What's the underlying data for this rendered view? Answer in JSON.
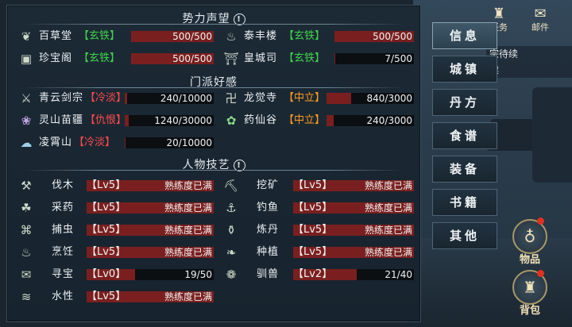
{
  "top_icons": [
    {
      "icon": "tower-icon",
      "label": "任务"
    },
    {
      "icon": "mail-icon",
      "label": "邮件"
    }
  ],
  "task_text": [
    "宗待续",
    "续"
  ],
  "sections": {
    "reputation": {
      "title": "势力声望",
      "items": [
        {
          "name": "百草堂",
          "tag": "【玄铁】",
          "value": "500/500",
          "fraction": 1.0,
          "icon": "herb-leaf-icon"
        },
        {
          "name": "泰丰楼",
          "tag": "【玄铁】",
          "value": "500/500",
          "fraction": 1.0,
          "icon": "cooking-pot-icon"
        },
        {
          "name": "珍宝阁",
          "tag": "【玄铁】",
          "value": "500/500",
          "fraction": 1.0,
          "icon": "treasure-chest-icon"
        },
        {
          "name": "皇城司",
          "tag": "【玄铁】",
          "value": "7/500",
          "fraction": 0.014,
          "icon": "pavilion-icon"
        }
      ]
    },
    "sects": {
      "title": "门派好感",
      "items": [
        {
          "name": "青云剑宗",
          "tag": "【冷淡】",
          "tag_color": "red",
          "value": "240/10000",
          "fraction": 0.024,
          "icon": "sword-icon"
        },
        {
          "name": "龙觉寺",
          "tag": "【中立】",
          "tag_color": "orange",
          "value": "840/3000",
          "fraction": 0.28,
          "icon": "buddha-icon"
        },
        {
          "name": "灵山苗疆",
          "tag": "【仇恨】",
          "tag_color": "red",
          "value": "1240/30000",
          "fraction": 0.041,
          "icon": "butterfly-icon"
        },
        {
          "name": "药仙谷",
          "tag": "【中立】",
          "tag_color": "orange",
          "value": "240/3000",
          "fraction": 0.08,
          "icon": "lotus-icon"
        },
        {
          "name": "凌霄山",
          "tag": "【冷淡】",
          "tag_color": "red",
          "value": "20/10000",
          "fraction": 0.002,
          "icon": "cloud-crane-icon"
        }
      ]
    },
    "skills": {
      "title": "人物技艺",
      "items": [
        {
          "name": "伐木",
          "level": "【Lv5】",
          "value": "熟练度已满",
          "fraction": 1.0,
          "icon": "axe-icon"
        },
        {
          "name": "挖矿",
          "level": "【Lv5】",
          "value": "熟练度已满",
          "fraction": 1.0,
          "icon": "pickaxe-icon"
        },
        {
          "name": "采药",
          "level": "【Lv5】",
          "value": "熟练度已满",
          "fraction": 1.0,
          "icon": "herb-sickle-icon"
        },
        {
          "name": "钓鱼",
          "level": "【Lv5】",
          "value": "熟练度已满",
          "fraction": 1.0,
          "icon": "fishing-rod-icon"
        },
        {
          "name": "捕虫",
          "level": "【Lv5】",
          "value": "熟练度已满",
          "fraction": 1.0,
          "icon": "bug-net-icon"
        },
        {
          "name": "炼丹",
          "level": "【Lv5】",
          "value": "熟练度已满",
          "fraction": 1.0,
          "icon": "pill-furnace-icon"
        },
        {
          "name": "烹饪",
          "level": "【Lv5】",
          "value": "熟练度已满",
          "fraction": 1.0,
          "icon": "cooking-icon"
        },
        {
          "name": "种植",
          "level": "【Lv5】",
          "value": "熟练度已满",
          "fraction": 1.0,
          "icon": "sprout-icon"
        },
        {
          "name": "寻宝",
          "level": "【Lv0】",
          "value": "19/50",
          "fraction": 0.38,
          "icon": "treasure-map-icon"
        },
        {
          "name": "驯兽",
          "level": "【Lv2】",
          "value": "21/40",
          "fraction": 0.525,
          "icon": "paw-icon"
        },
        {
          "name": "水性",
          "level": "【Lv5】",
          "value": "熟练度已满",
          "fraction": 1.0,
          "icon": "water-wave-icon"
        }
      ]
    }
  },
  "menu": [
    {
      "label": "信息",
      "active": true
    },
    {
      "label": "城镇",
      "active": false
    },
    {
      "label": "丹方",
      "active": false
    },
    {
      "label": "食谱",
      "active": false
    },
    {
      "label": "装备",
      "active": false
    },
    {
      "label": "书籍",
      "active": false
    },
    {
      "label": "其他",
      "active": false
    }
  ],
  "side_buttons": [
    {
      "label": "物品",
      "icon": "bag-icon"
    },
    {
      "label": "背包",
      "icon": "backpack-icon"
    }
  ],
  "colors": {
    "fill": "#7a1f1f",
    "green_tag": "#3fd24a",
    "red_tag": "#ff4a4a",
    "orange_tag": "#ff9a1f"
  }
}
